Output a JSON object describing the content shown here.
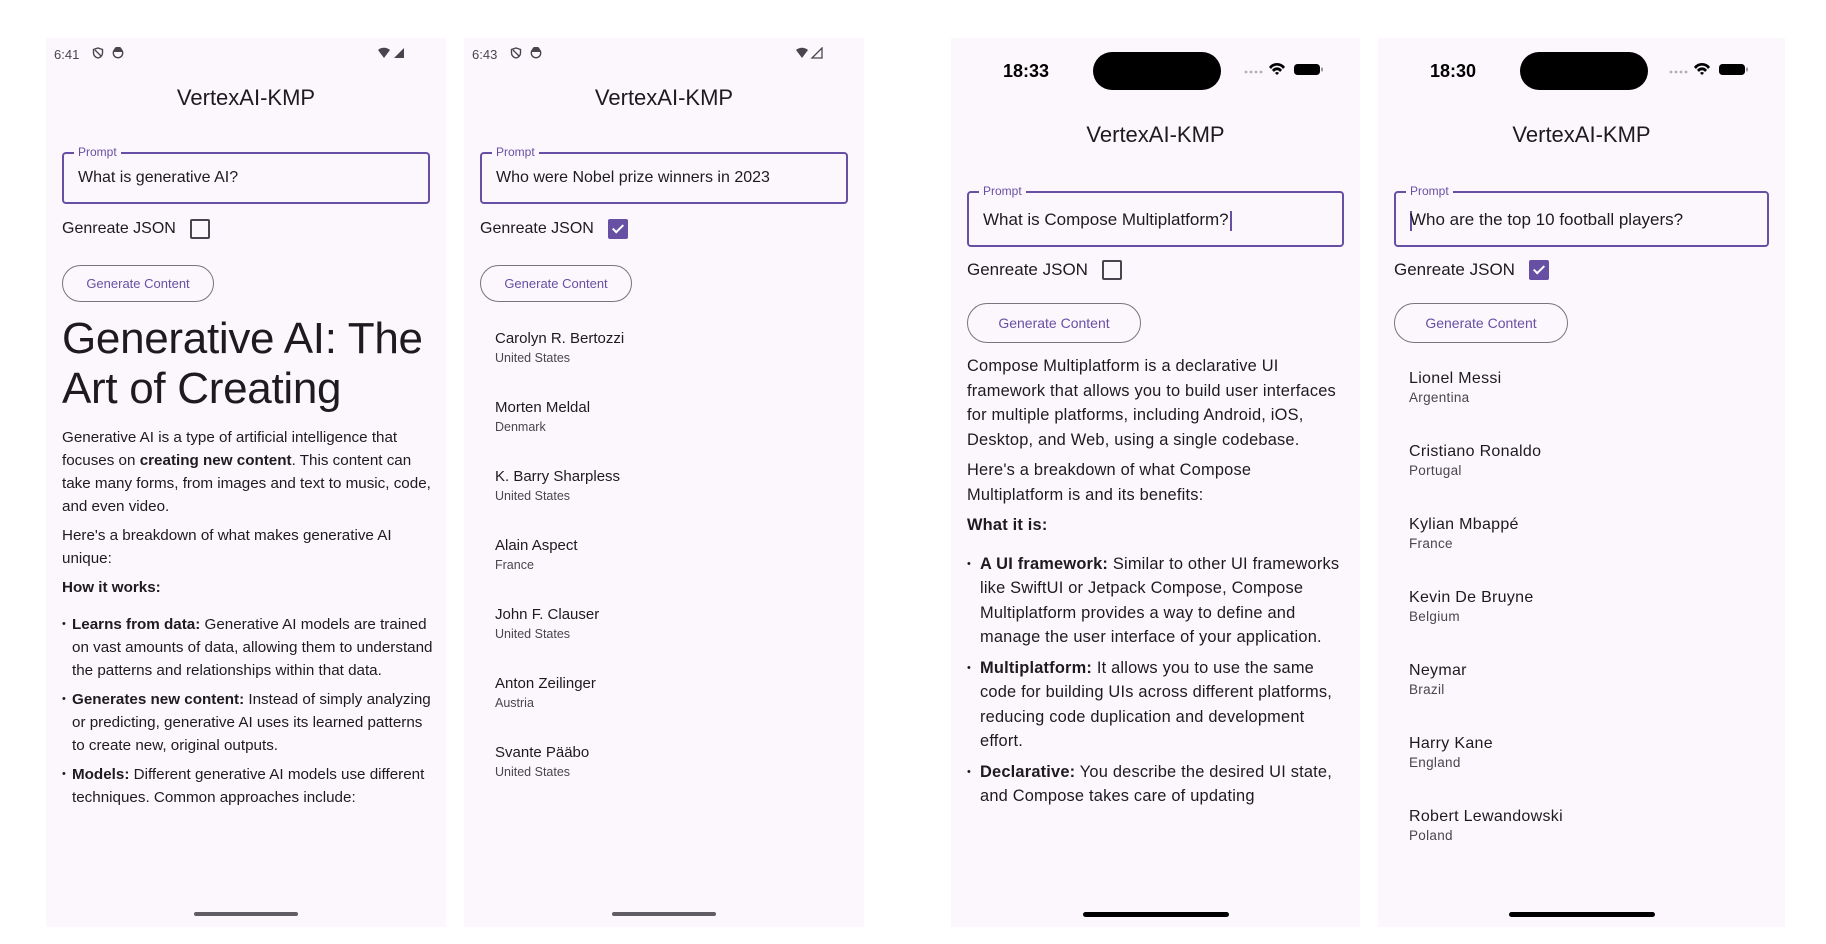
{
  "screens": [
    {
      "platform": "android",
      "status": {
        "time": "6:41",
        "icons": [
          "shield-icon",
          "face-icon",
          "wifi-icon",
          "cellular-icon"
        ]
      },
      "title": "VertexAI-KMP",
      "prompt": {
        "label": "Prompt",
        "value": "What is generative AI?"
      },
      "json_toggle": {
        "label": "Genreate JSON",
        "checked": false
      },
      "button": "Generate Content",
      "response": {
        "heading": "Generative AI: The Art of Creating",
        "intro_before_bold": "Generative AI is a type of artificial intelligence that focuses on ",
        "intro_bold": "creating new content",
        "intro_after_bold": ". This content can take many forms, from images and text to music, code, and even video.",
        "breakdown": "Here's a breakdown of what makes generative AI unique:",
        "subheading": "How it works:",
        "bullets": [
          {
            "term": "Learns from data:",
            "text": " Generative AI models are trained on vast amounts of data, allowing them to understand the patterns and relationships within that data."
          },
          {
            "term": "Generates new content:",
            "text": " Instead of simply analyzing or predicting, generative AI uses its learned patterns to create new, original outputs."
          },
          {
            "term": "Models:",
            "text": " Different generative AI models use different techniques. Common approaches include:"
          }
        ]
      }
    },
    {
      "platform": "android",
      "status": {
        "time": "6:43",
        "icons": [
          "shield-icon",
          "face-icon",
          "wifi-icon",
          "cellular-icon"
        ]
      },
      "title": "VertexAI-KMP",
      "prompt": {
        "label": "Prompt",
        "value": "Who were Nobel prize winners in 2023"
      },
      "json_toggle": {
        "label": "Genreate JSON",
        "checked": true
      },
      "button": "Generate Content",
      "items": [
        {
          "name": "Carolyn R. Bertozzi",
          "country": "United States"
        },
        {
          "name": "Morten Meldal",
          "country": "Denmark"
        },
        {
          "name": "K. Barry Sharpless",
          "country": "United States"
        },
        {
          "name": "Alain Aspect",
          "country": "France"
        },
        {
          "name": "John F. Clauser",
          "country": "United States"
        },
        {
          "name": "Anton Zeilinger",
          "country": "Austria"
        },
        {
          "name": "Svante Pääbo",
          "country": "United States"
        }
      ]
    },
    {
      "platform": "ios",
      "status": {
        "time": "18:33",
        "icons": [
          "signal-dots-icon",
          "wifi-icon",
          "battery-icon"
        ]
      },
      "title": "VertexAI-KMP",
      "prompt": {
        "label": "Prompt",
        "value": "What is Compose Multiplatform?"
      },
      "json_toggle": {
        "label": "Genreate JSON",
        "checked": false
      },
      "button": "Generate Content",
      "response": {
        "intro": "Compose Multiplatform is a declarative UI framework that allows you to build user interfaces for multiple platforms, including Android, iOS, Desktop, and Web, using a single codebase.",
        "breakdown": "Here's a breakdown of what Compose Multiplatform is and its benefits:",
        "subheading": "What it is:",
        "bullets": [
          {
            "term": "A UI framework:",
            "text": " Similar to other UI frameworks like SwiftUI or Jetpack Compose, Compose Multiplatform provides a way to define and manage the user interface of your application."
          },
          {
            "term": "Multiplatform:",
            "text": " It allows you to use the same code for building UIs across different platforms, reducing code duplication and development effort."
          },
          {
            "term": "Declarative:",
            "text": " You describe the desired UI state, and Compose takes care of updating"
          }
        ]
      }
    },
    {
      "platform": "ios",
      "status": {
        "time": "18:30",
        "icons": [
          "signal-dots-icon",
          "wifi-icon",
          "battery-icon"
        ]
      },
      "title": "VertexAI-KMP",
      "prompt": {
        "label": "Prompt",
        "value": "Who are the top 10 football players?"
      },
      "json_toggle": {
        "label": "Genreate JSON",
        "checked": true
      },
      "button": "Generate Content",
      "items": [
        {
          "name": "Lionel Messi",
          "country": "Argentina"
        },
        {
          "name": "Cristiano Ronaldo",
          "country": "Portugal"
        },
        {
          "name": "Kylian Mbappé",
          "country": "France"
        },
        {
          "name": "Kevin De Bruyne",
          "country": "Belgium"
        },
        {
          "name": "Neymar",
          "country": "Brazil"
        },
        {
          "name": "Harry Kane",
          "country": "England"
        },
        {
          "name": "Robert Lewandowski",
          "country": "Poland"
        }
      ]
    }
  ]
}
